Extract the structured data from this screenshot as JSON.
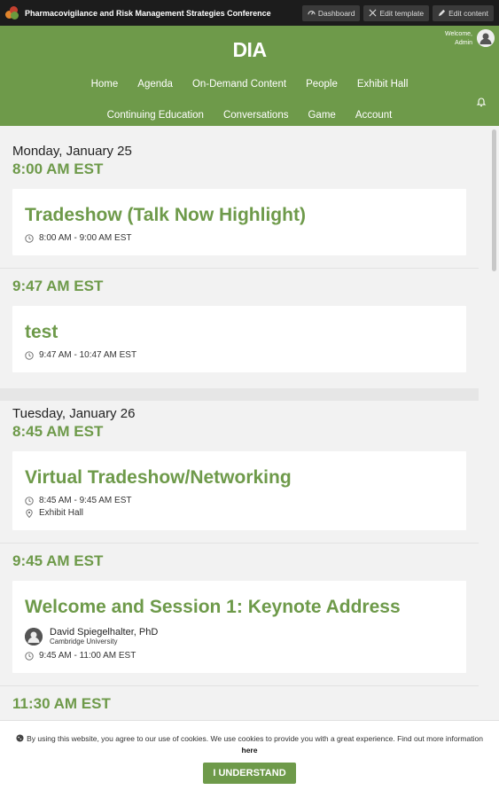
{
  "admin_bar": {
    "title": "Pharmacovigilance and Risk Management Strategies Conference",
    "buttons": [
      "Dashboard",
      "Edit template",
      "Edit content"
    ]
  },
  "header": {
    "logo": "DIA",
    "welcome_line1": "Welcome,",
    "welcome_line2": "Admin",
    "nav_row1": [
      "Home",
      "Agenda",
      "On-Demand Content",
      "People",
      "Exhibit Hall"
    ],
    "nav_row2": [
      "Continuing Education",
      "Conversations",
      "Game",
      "Account"
    ]
  },
  "days": [
    {
      "label": "Monday, January 25",
      "slots": [
        {
          "time": "8:00 AM EST",
          "sessions": [
            {
              "title": "Tradeshow (Talk Now Highlight)",
              "time": "8:00 AM - 9:00 AM EST"
            }
          ]
        },
        {
          "time": "9:47 AM EST",
          "sessions": [
            {
              "title": "test",
              "time": "9:47 AM - 10:47 AM EST"
            }
          ]
        }
      ]
    },
    {
      "label": "Tuesday, January 26",
      "slots": [
        {
          "time": "8:45 AM EST",
          "sessions": [
            {
              "title": "Virtual Tradeshow/Networking",
              "time": "8:45 AM - 9:45 AM EST",
              "location": "Exhibit Hall"
            }
          ]
        },
        {
          "time": "9:45 AM EST",
          "sessions": [
            {
              "title": "Welcome and Session 1: Keynote Address",
              "speaker": "David Spiegelhalter, PhD",
              "speaker_org": "Cambridge University",
              "time": "9:45 AM - 11:00 AM EST"
            }
          ]
        },
        {
          "time": "11:30 AM EST",
          "sessions": []
        }
      ]
    }
  ],
  "cookie": {
    "text": "By using this website, you agree to our use of cookies. We use cookies to provide you with a great experience. Find out more information",
    "link": "here",
    "button": "I UNDERSTAND"
  },
  "colors": {
    "brand": "#6e9a4a",
    "admin_bar": "#1c1c1c"
  }
}
